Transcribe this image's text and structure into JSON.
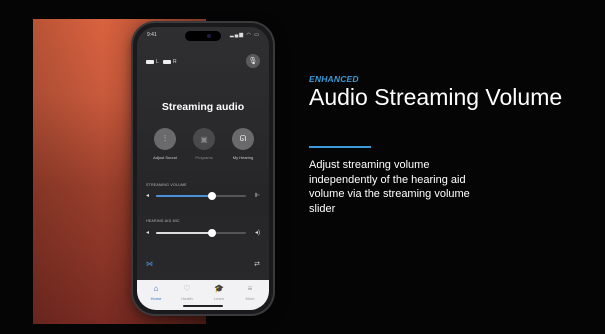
{
  "phone": {
    "status_time": "9:41",
    "status_icons": "▂▄▆ ◠ ▭",
    "hearing_aids": {
      "left": "L",
      "right": "R"
    },
    "screen_title": "Streaming audio",
    "actions": [
      {
        "label": "Adjust Sound",
        "icon": "sliders-icon"
      },
      {
        "label": "Programs",
        "icon": "programs-icon"
      },
      {
        "label": "My Hearing",
        "icon": "ear-icon"
      }
    ],
    "streaming_volume": {
      "label": "STREAMING VOLUME",
      "level": 0.62
    },
    "hearing_aid_mic": {
      "label": "HEARING AID MIC",
      "level": 0.62
    },
    "tabs": [
      {
        "label": "Home",
        "icon": "home-icon",
        "active": true
      },
      {
        "label": "Health",
        "icon": "heart-icon",
        "active": false
      },
      {
        "label": "Learn",
        "icon": "learn-icon",
        "active": false
      },
      {
        "label": "More",
        "icon": "menu-icon",
        "active": false
      }
    ]
  },
  "slide": {
    "badge": "ENHANCED",
    "headline": "Audio Streaming Volume",
    "description": "Adjust streaming volume independently of the hearing aid volume via the streaming volume slider"
  },
  "colors": {
    "accent": "#3a9bd8",
    "slider_fill": "#4a90d9",
    "tab_active": "#2f6fc4"
  }
}
